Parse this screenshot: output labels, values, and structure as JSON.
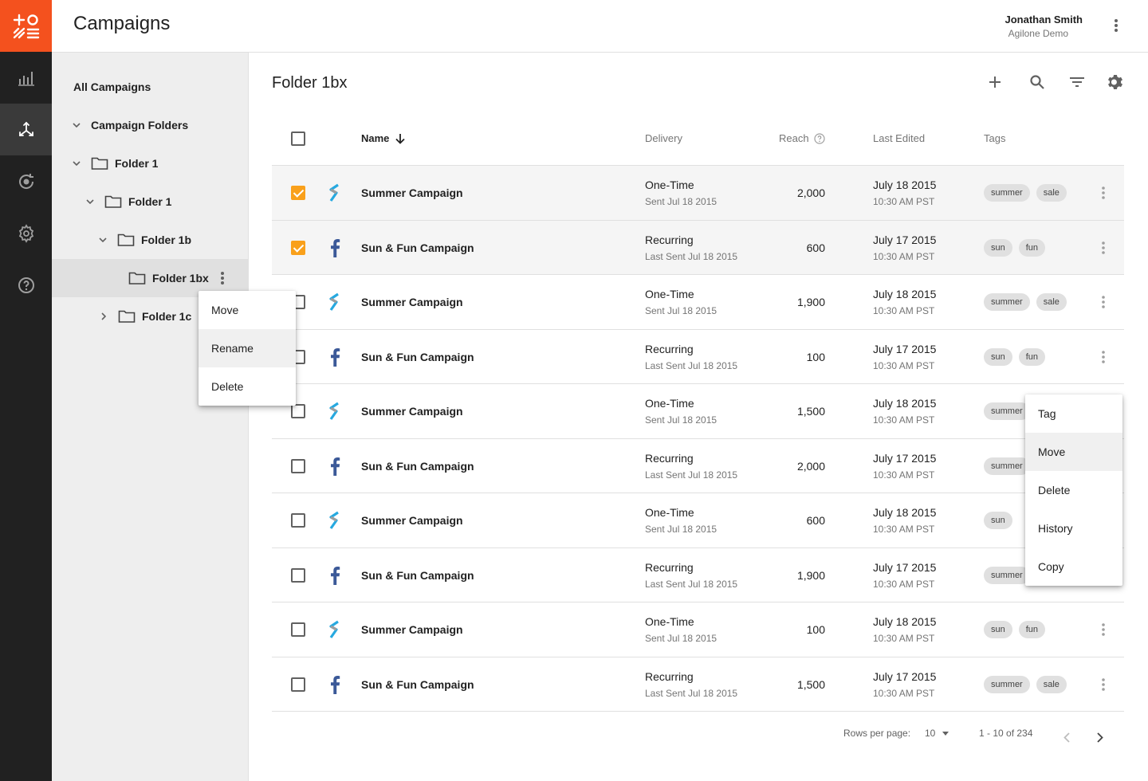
{
  "app": {
    "title": "Campaigns"
  },
  "user": {
    "name": "Jonathan Smith",
    "org": "Agilone Demo"
  },
  "rail": {
    "logo_icon": "agilone-logo-icon",
    "items": [
      {
        "icon": "bar-chart-icon",
        "active": false
      },
      {
        "icon": "campaigns-arrows-icon",
        "active": true
      },
      {
        "icon": "refresh-target-icon",
        "active": false
      },
      {
        "icon": "gear-icon",
        "active": false
      },
      {
        "icon": "help-icon",
        "active": false
      }
    ]
  },
  "sidebar": {
    "all_campaigns": "All Campaigns",
    "campaign_folders": "Campaign Folders",
    "folder_1": "Folder 1",
    "folder_1_sub": "Folder 1",
    "folder_1b": "Folder 1b",
    "folder_1bx": "Folder 1bx",
    "folder_1c": "Folder 1c"
  },
  "folder_menu": {
    "items": [
      "Move",
      "Rename",
      "Delete"
    ],
    "hovered": "Rename"
  },
  "main": {
    "title": "Folder 1bx",
    "toolbar": {
      "add": "plus-icon",
      "search": "search-icon",
      "filter": "filter-icon",
      "settings": "gear-icon"
    }
  },
  "table": {
    "columns": {
      "name": "Name",
      "delivery": "Delivery",
      "reach": "Reach",
      "last_edited": "Last Edited",
      "tags": "Tags"
    },
    "rows": [
      {
        "checked": true,
        "channel": "email",
        "name": "Summer Campaign",
        "delivery": "One-Time",
        "delivery_sub": "Sent Jul 18 2015",
        "reach": "2,000",
        "edited": "July 18 2015",
        "edited_time": "10:30 AM PST",
        "tags": [
          "summer",
          "sale"
        ]
      },
      {
        "checked": true,
        "channel": "facebook",
        "name": "Sun & Fun Campaign",
        "delivery": "Recurring",
        "delivery_sub": "Last Sent Jul 18 2015",
        "reach": "600",
        "edited": "July 17 2015",
        "edited_time": "10:30 AM PST",
        "tags": [
          "sun",
          "fun"
        ]
      },
      {
        "checked": false,
        "channel": "email",
        "name": "Summer Campaign",
        "delivery": "One-Time",
        "delivery_sub": "Sent Jul 18 2015",
        "reach": "1,900",
        "edited": "July 18 2015",
        "edited_time": "10:30 AM PST",
        "tags": [
          "summer",
          "sale"
        ]
      },
      {
        "checked": false,
        "channel": "facebook",
        "name": "Sun & Fun Campaign",
        "delivery": "Recurring",
        "delivery_sub": "Last Sent Jul 18 2015",
        "reach": "100",
        "edited": "July 17 2015",
        "edited_time": "10:30 AM PST",
        "tags": [
          "sun",
          "fun"
        ]
      },
      {
        "checked": false,
        "channel": "email",
        "name": "Summer Campaign",
        "delivery": "One-Time",
        "delivery_sub": "Sent Jul 18 2015",
        "reach": "1,500",
        "edited": "July 18 2015",
        "edited_time": "10:30 AM PST",
        "tags": [
          "summer"
        ]
      },
      {
        "checked": false,
        "channel": "facebook",
        "name": "Sun & Fun Campaign",
        "delivery": "Recurring",
        "delivery_sub": "Last Sent Jul 18 2015",
        "reach": "2,000",
        "edited": "July 17 2015",
        "edited_time": "10:30 AM PST",
        "tags": [
          "summer"
        ]
      },
      {
        "checked": false,
        "channel": "email",
        "name": "Summer Campaign",
        "delivery": "One-Time",
        "delivery_sub": "Sent Jul 18 2015",
        "reach": "600",
        "edited": "July 18 2015",
        "edited_time": "10:30 AM PST",
        "tags": [
          "sun"
        ]
      },
      {
        "checked": false,
        "channel": "facebook",
        "name": "Sun & Fun Campaign",
        "delivery": "Recurring",
        "delivery_sub": "Last Sent Jul 18 2015",
        "reach": "1,900",
        "edited": "July 17 2015",
        "edited_time": "10:30 AM PST",
        "tags": [
          "summer"
        ]
      },
      {
        "checked": false,
        "channel": "email",
        "name": "Summer Campaign",
        "delivery": "One-Time",
        "delivery_sub": "Sent Jul 18 2015",
        "reach": "100",
        "edited": "July 18 2015",
        "edited_time": "10:30 AM PST",
        "tags": [
          "sun",
          "fun"
        ]
      },
      {
        "checked": false,
        "channel": "facebook",
        "name": "Sun & Fun Campaign",
        "delivery": "Recurring",
        "delivery_sub": "Last Sent Jul 18 2015",
        "reach": "1,500",
        "edited": "July 17 2015",
        "edited_time": "10:30 AM PST",
        "tags": [
          "summer",
          "sale"
        ]
      }
    ]
  },
  "row_menu": {
    "items": [
      "Tag",
      "Move",
      "Delete",
      "History",
      "Copy"
    ],
    "hovered": "Move"
  },
  "pagination": {
    "rows_per_page_label": "Rows per page:",
    "rows_per_page": "10",
    "range": "1 - 10 of 234"
  },
  "colors": {
    "brand": "#f4511e",
    "check": "#f9a01b",
    "facebook": "#3b5998",
    "email": "#26a9e0"
  }
}
